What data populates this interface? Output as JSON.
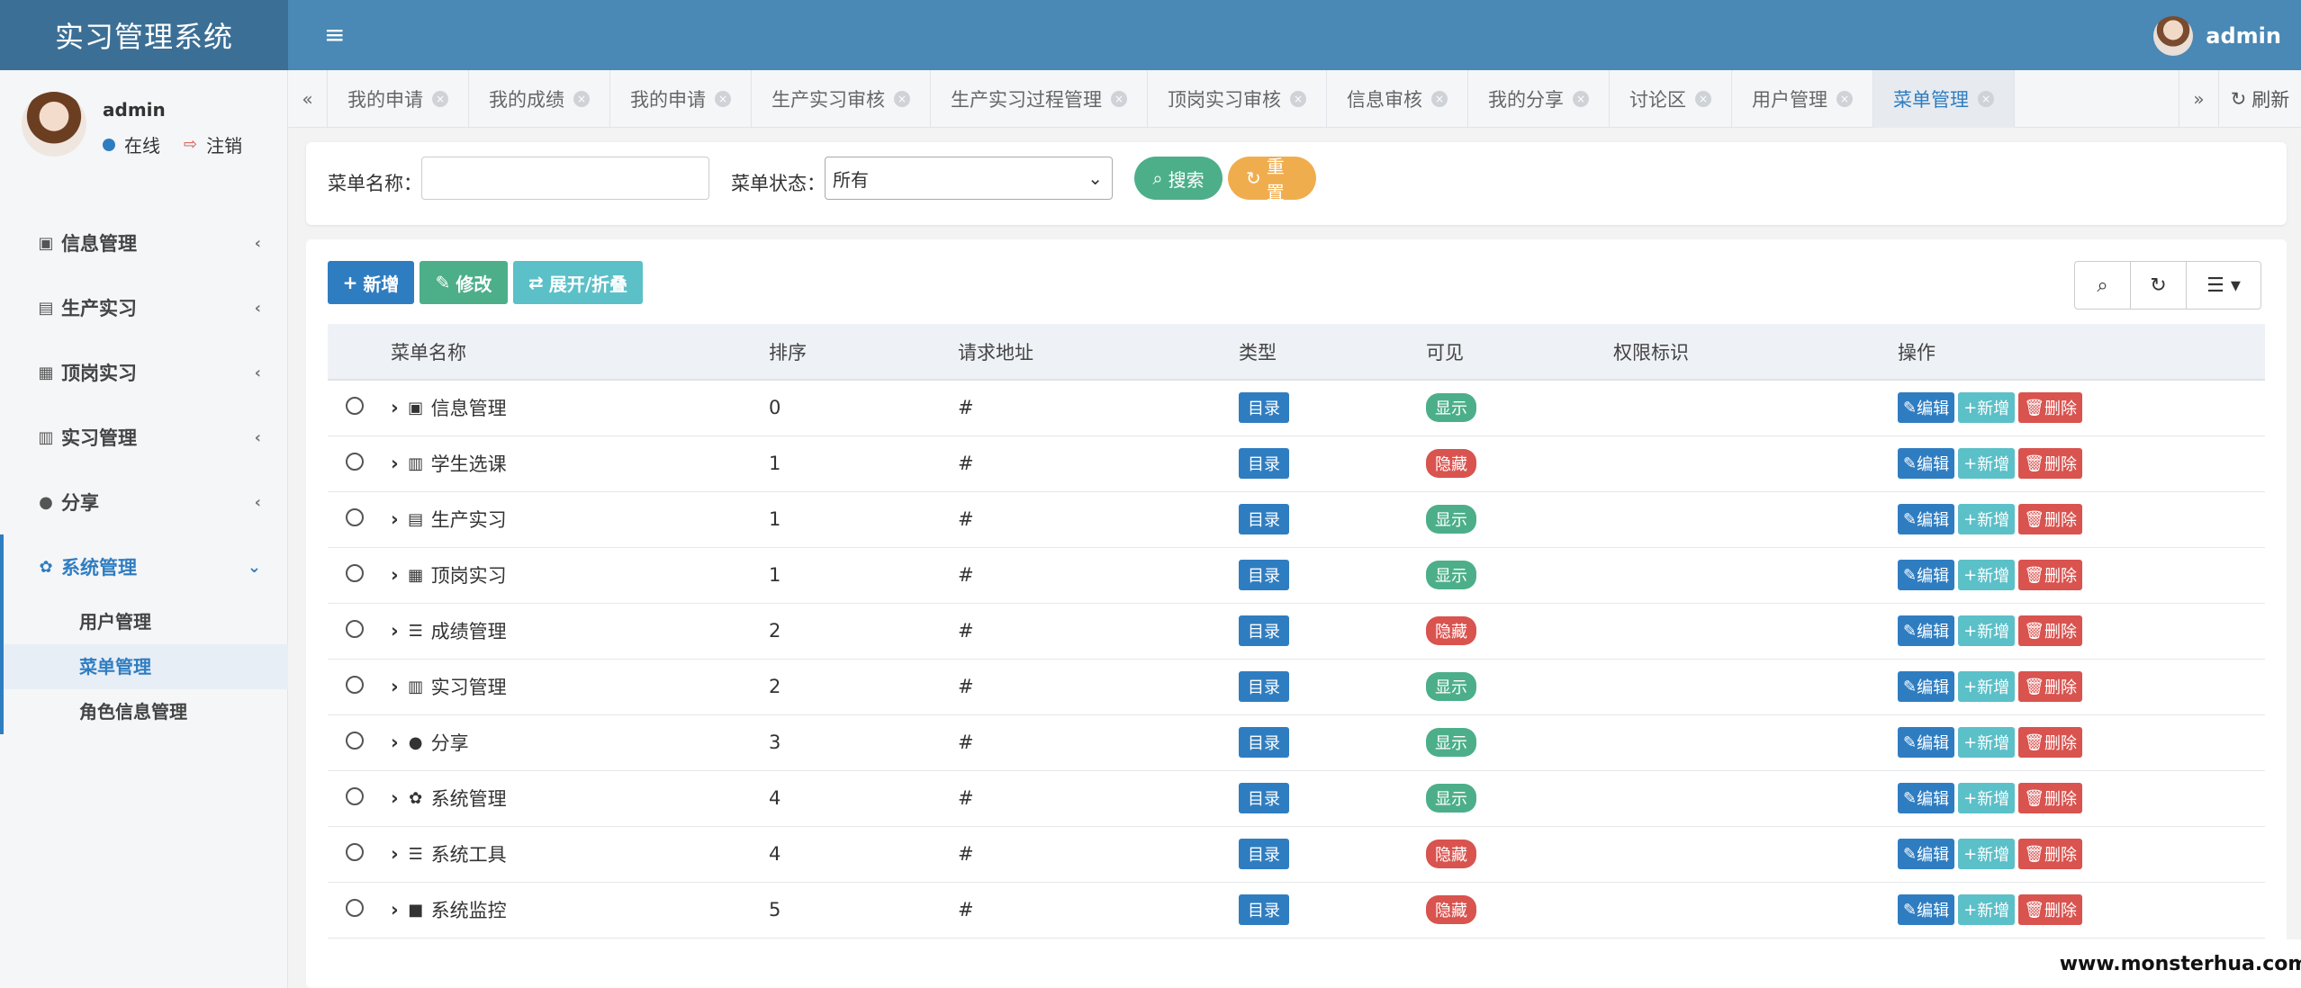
{
  "app": {
    "title": "实习管理系统"
  },
  "top": {
    "user": "admin"
  },
  "user_panel": {
    "name": "admin",
    "status": "在线",
    "logout": "注销"
  },
  "sidebar": {
    "items": [
      {
        "label": "信息管理",
        "icon": "id-badge-icon"
      },
      {
        "label": "生产实习",
        "icon": "person-card-icon"
      },
      {
        "label": "顶岗实习",
        "icon": "id-card-icon"
      },
      {
        "label": "实习管理",
        "icon": "address-card-icon"
      },
      {
        "label": "分享",
        "icon": "comment-icon"
      },
      {
        "label": "系统管理",
        "icon": "gear-icon"
      }
    ],
    "sub_items": [
      "用户管理",
      "菜单管理",
      "角色信息管理"
    ]
  },
  "tabs": [
    "我的申请",
    "我的成绩",
    "我的申请",
    "生产实习审核",
    "生产实习过程管理",
    "顶岗实习审核",
    "信息审核",
    "我的分享",
    "讨论区",
    "用户管理",
    "菜单管理"
  ],
  "refresh_label": "刷新",
  "search": {
    "name_label": "菜单名称：",
    "name_placeholder": "",
    "status_label": "菜单状态：",
    "status_value": "所有",
    "search_button": "搜索",
    "reset_button": "重置"
  },
  "toolbar": {
    "add": "新增",
    "edit": "修改",
    "expand": "展开/折叠"
  },
  "table": {
    "columns": [
      "菜单名称",
      "排序",
      "请求地址",
      "类型",
      "可见",
      "权限标识",
      "操作"
    ],
    "actions": {
      "edit": "编辑",
      "add": "新增",
      "delete": "删除"
    },
    "rows": [
      {
        "name": "信息管理",
        "icon": "id-badge-icon",
        "order": "0",
        "url": "#",
        "type": "目录",
        "visible": "显示"
      },
      {
        "name": "学生选课",
        "icon": "bar-chart-icon",
        "order": "1",
        "url": "#",
        "type": "目录",
        "visible": "隐藏"
      },
      {
        "name": "生产实习",
        "icon": "person-card-icon",
        "order": "1",
        "url": "#",
        "type": "目录",
        "visible": "显示"
      },
      {
        "name": "顶岗实习",
        "icon": "id-card-icon",
        "order": "1",
        "url": "#",
        "type": "目录",
        "visible": "显示"
      },
      {
        "name": "成绩管理",
        "icon": "list-icon",
        "order": "2",
        "url": "#",
        "type": "目录",
        "visible": "隐藏"
      },
      {
        "name": "实习管理",
        "icon": "address-card-icon",
        "order": "2",
        "url": "#",
        "type": "目录",
        "visible": "显示"
      },
      {
        "name": "分享",
        "icon": "comment-icon",
        "order": "3",
        "url": "#",
        "type": "目录",
        "visible": "显示"
      },
      {
        "name": "系统管理",
        "icon": "gear-icon",
        "order": "4",
        "url": "#",
        "type": "目录",
        "visible": "显示"
      },
      {
        "name": "系统工具",
        "icon": "list-icon",
        "order": "4",
        "url": "#",
        "type": "目录",
        "visible": "隐藏"
      },
      {
        "name": "系统监控",
        "icon": "video-camera-icon",
        "order": "5",
        "url": "#",
        "type": "目录",
        "visible": "隐藏"
      }
    ]
  },
  "watermark": "www.monsterhua.com",
  "colors": {
    "primary": "#2f7dc1",
    "header": "#4a88b5",
    "logo_bg": "#3c6f95",
    "success": "#4caf8a",
    "info": "#5bc0c8",
    "danger": "#d9534f",
    "warning": "#f0ad4e"
  }
}
